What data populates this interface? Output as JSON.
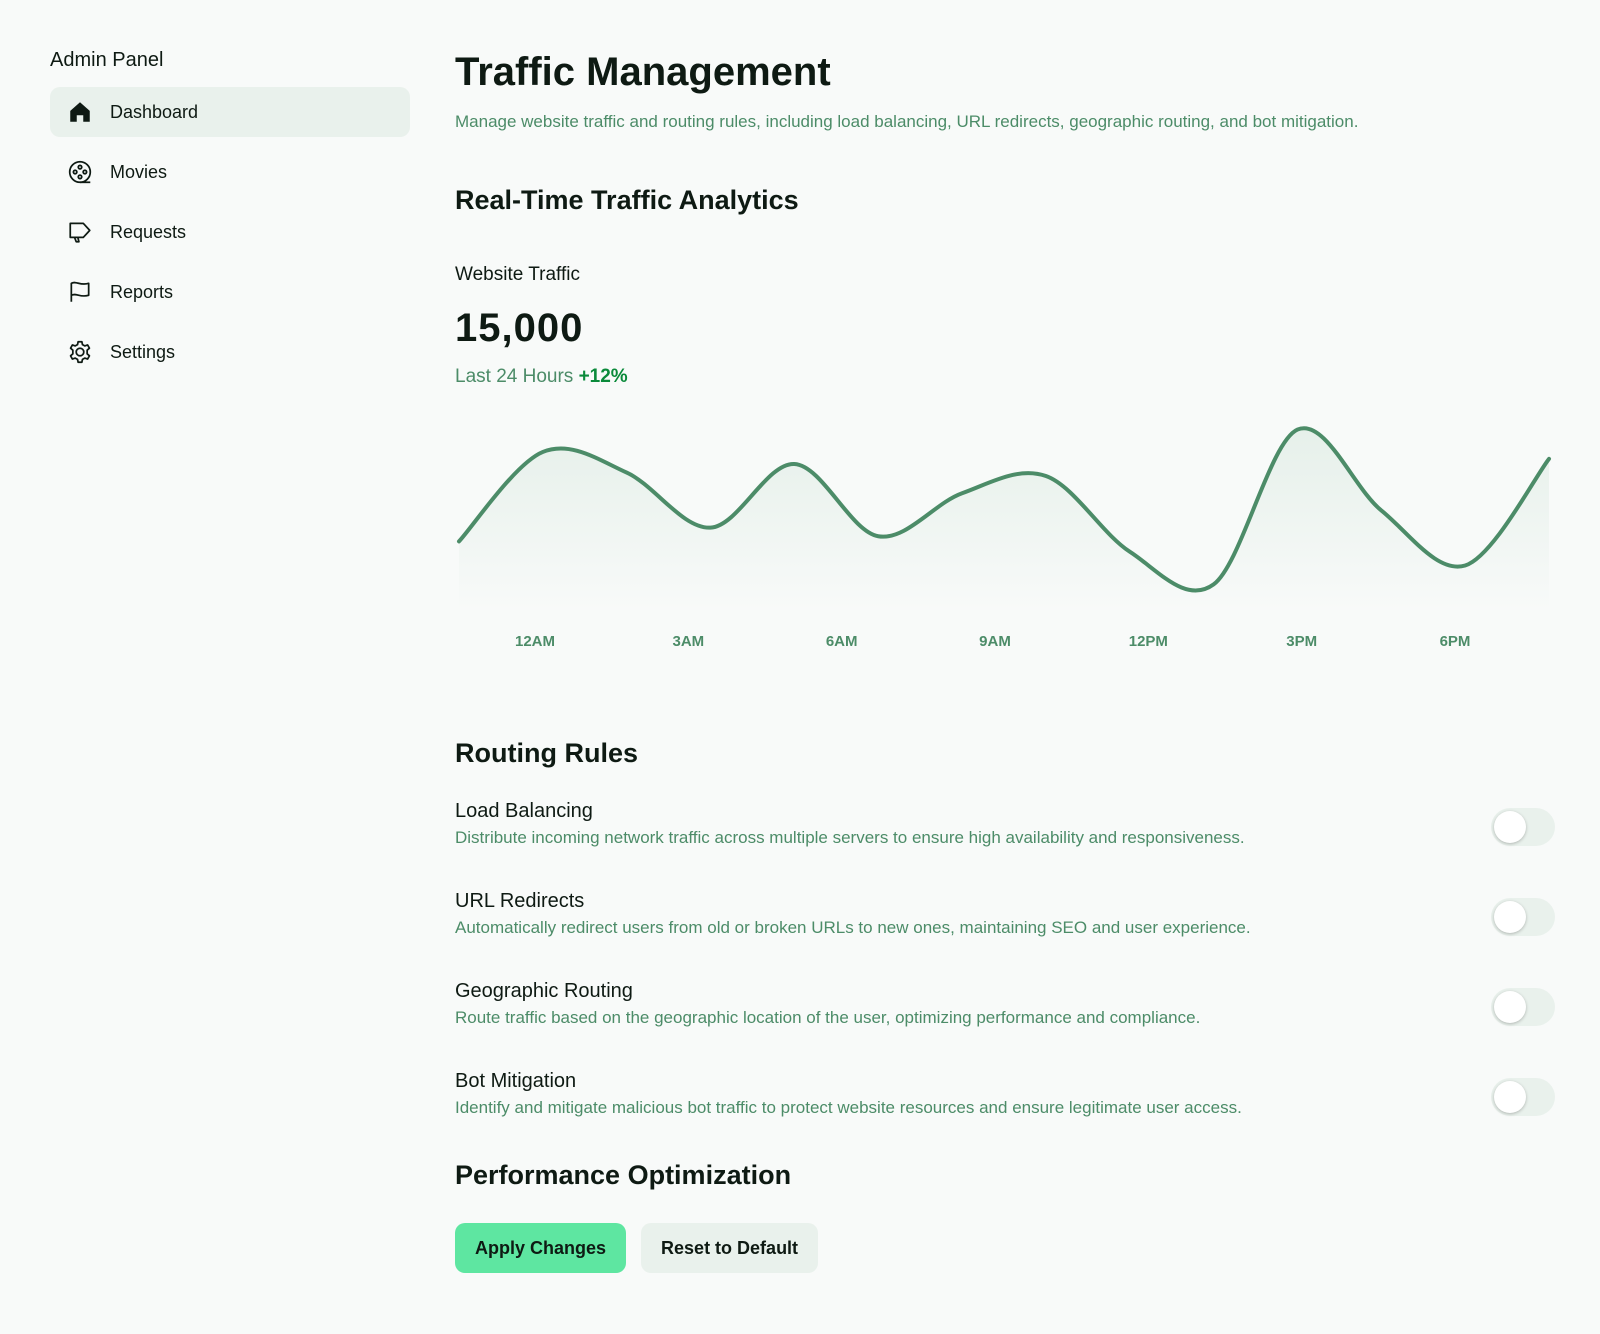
{
  "sidebar": {
    "title": "Admin Panel",
    "items": [
      {
        "label": "Dashboard",
        "icon": "home-icon",
        "active": true
      },
      {
        "label": "Movies",
        "icon": "film-reel-icon",
        "active": false
      },
      {
        "label": "Requests",
        "icon": "megaphone-icon",
        "active": false
      },
      {
        "label": "Reports",
        "icon": "flag-icon",
        "active": false
      },
      {
        "label": "Settings",
        "icon": "gear-icon",
        "active": false
      }
    ]
  },
  "header": {
    "title": "Traffic Management",
    "subtitle": "Manage website traffic and routing rules, including load balancing, URL redirects, geographic routing, and bot mitigation."
  },
  "analytics": {
    "section_title": "Real-Time Traffic Analytics",
    "stat_label": "Website Traffic",
    "stat_value": "15,000",
    "stat_period": "Last 24 Hours",
    "stat_change": "+12%"
  },
  "chart_data": {
    "type": "area",
    "x_labels": [
      "12AM",
      "3AM",
      "6AM",
      "9AM",
      "12PM",
      "3PM",
      "6PM"
    ],
    "series": [
      {
        "values": [
          {
            "x": 0,
            "y": 0.3
          },
          {
            "x": 2,
            "y": 0.82
          },
          {
            "x": 4,
            "y": 0.7
          },
          {
            "x": 6,
            "y": 0.38
          },
          {
            "x": 8,
            "y": 0.75
          },
          {
            "x": 10,
            "y": 0.33
          },
          {
            "x": 12,
            "y": 0.58
          },
          {
            "x": 14,
            "y": 0.68
          },
          {
            "x": 16,
            "y": 0.24
          },
          {
            "x": 18,
            "y": 0.05
          },
          {
            "x": 20,
            "y": 0.95
          },
          {
            "x": 22,
            "y": 0.48
          },
          {
            "x": 24,
            "y": 0.16
          },
          {
            "x": 26,
            "y": 0.78
          }
        ]
      }
    ],
    "xlim": [
      0,
      26
    ],
    "ylim": [
      0,
      1
    ],
    "grid": false,
    "line_color": "#4c8c68"
  },
  "routing": {
    "section_title": "Routing Rules",
    "rules": [
      {
        "title": "Load Balancing",
        "description": "Distribute incoming network traffic across multiple servers to ensure high availability and responsiveness.",
        "enabled": false
      },
      {
        "title": "URL Redirects",
        "description": "Automatically redirect users from old or broken URLs to new ones, maintaining SEO and user experience.",
        "enabled": false
      },
      {
        "title": "Geographic Routing",
        "description": "Route traffic based on the geographic location of the user, optimizing performance and compliance.",
        "enabled": false
      },
      {
        "title": "Bot Mitigation",
        "description": "Identify and mitigate malicious bot traffic to protect website resources and ensure legitimate user access.",
        "enabled": false
      }
    ]
  },
  "performance": {
    "section_title": "Performance Optimization",
    "apply_label": "Apply Changes",
    "reset_label": "Reset to Default"
  },
  "colors": {
    "accent": "#5ee6a1",
    "muted_green": "#4c8c68",
    "positive": "#0a8a3a",
    "surface": "#e9f1ec"
  }
}
